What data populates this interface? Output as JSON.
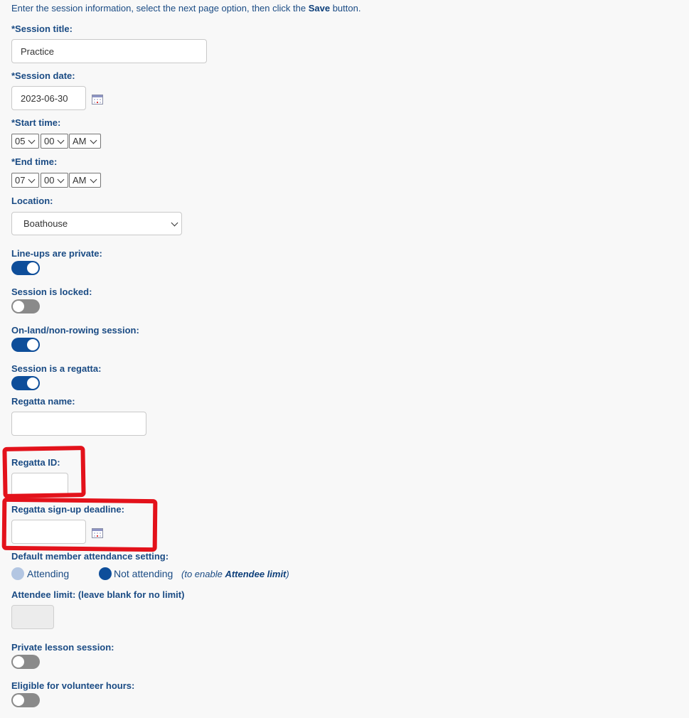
{
  "instructions": {
    "before": "Enter the session information, select the next page option, then click the ",
    "bold": "Save",
    "after": " button."
  },
  "fields": {
    "session_title": {
      "label": "*Session title:",
      "value": "Practice"
    },
    "session_date": {
      "label": "*Session date:",
      "value": "2023-06-30"
    },
    "start_time": {
      "label": "*Start time:",
      "hour": "05",
      "minute": "00",
      "ampm": "AM"
    },
    "end_time": {
      "label": "*End time:",
      "hour": "07",
      "minute": "00",
      "ampm": "AM"
    },
    "location": {
      "label": "Location:",
      "value": "Boathouse"
    },
    "lineups_private": {
      "label": "Line-ups are private:",
      "on": true
    },
    "session_locked": {
      "label": "Session is locked:",
      "on": false
    },
    "on_land": {
      "label": "On-land/non-rowing session:",
      "on": true
    },
    "regatta": {
      "label": "Session is a regatta:",
      "on": true
    },
    "regatta_name": {
      "label": "Regatta name:",
      "value": ""
    },
    "regatta_id": {
      "label": "Regatta ID:",
      "value": ""
    },
    "regatta_deadline": {
      "label": "Regatta sign-up deadline:",
      "value": ""
    },
    "default_attendance": {
      "label": "Default member attendance setting:",
      "options": [
        "Attending",
        "Not attending"
      ],
      "selected": "Not attending",
      "note_before": "(to enable ",
      "note_bold": "Attendee limit",
      "note_after": ")"
    },
    "attendee_limit": {
      "label": "Attendee limit: (leave blank for no limit)",
      "value": ""
    },
    "private_lesson": {
      "label": "Private lesson session:",
      "on": false
    },
    "volunteer_hours": {
      "label": "Eligible for volunteer hours:",
      "on": false
    }
  },
  "colors": {
    "label_text": "#1a4b84",
    "toggle_on": "#0e4e9a",
    "toggle_off": "#8a8a8a",
    "annotation": "#e3121b"
  }
}
